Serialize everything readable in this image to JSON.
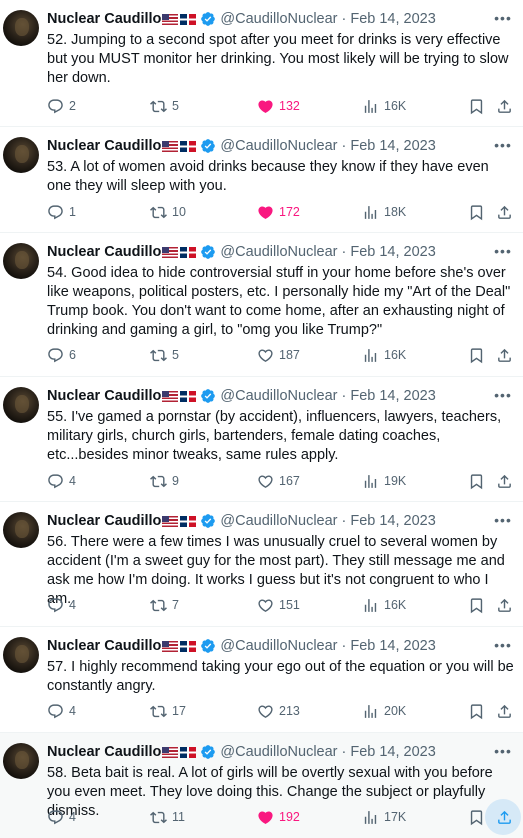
{
  "colors": {
    "like_active": "#f91880",
    "muted": "#536471",
    "text": "#0f1419",
    "highlight_bg": "#f7f9f9",
    "verified": "#1d9bf0"
  },
  "tweets": [
    {
      "name": "Nuclear Caudillo",
      "handle": "@CaudilloNuclear",
      "date": "Feb 14, 2023",
      "text": "52. Jumping to a second spot after you meet for drinks is very effective but you MUST monitor her drinking. You most likely will be trying to slow her down.",
      "replies": "2",
      "retweets": "5",
      "likes": "132",
      "liked": true,
      "views": "16K"
    },
    {
      "name": "Nuclear Caudillo",
      "handle": "@CaudilloNuclear",
      "date": "Feb 14, 2023",
      "text": "53.  A lot of women avoid drinks because they know if they have even one they will sleep with you.",
      "replies": "1",
      "retweets": "10",
      "likes": "172",
      "liked": true,
      "views": "18K"
    },
    {
      "name": "Nuclear Caudillo",
      "handle": "@CaudilloNuclear",
      "date": "Feb 14, 2023",
      "text": "54. Good idea to hide controversial stuff in your home before she's over like weapons, political posters, etc. I personally hide my \"Art of the Deal\" Trump book. You don't want to come home, after an exhausting night of drinking and gaming a girl, to \"omg you like Trump?\"",
      "replies": "6",
      "retweets": "5",
      "likes": "187",
      "liked": false,
      "views": "16K"
    },
    {
      "name": "Nuclear Caudillo",
      "handle": "@CaudilloNuclear",
      "date": "Feb 14, 2023",
      "text": "55. I've gamed a pornstar (by accident), influencers, lawyers, teachers, military girls, church girls, bartenders, female dating coaches, etc...besides minor tweaks, same rules apply.",
      "replies": "4",
      "retweets": "9",
      "likes": "167",
      "liked": false,
      "views": "19K"
    },
    {
      "name": "Nuclear Caudillo",
      "handle": "@CaudilloNuclear",
      "date": "Feb 14, 2023",
      "text": "56. There were a few times I was unusually cruel to several women by accident (I'm a sweet guy for the most part). They still message me and ask me how I'm doing. It works I guess but it's not congruent to who I am.",
      "replies": "4",
      "retweets": "7",
      "likes": "151",
      "liked": false,
      "views": "16K"
    },
    {
      "name": "Nuclear Caudillo",
      "handle": "@CaudilloNuclear",
      "date": "Feb 14, 2023",
      "text": "57. I highly recommend taking your ego out of the equation or you will be constantly angry.",
      "replies": "4",
      "retweets": "17",
      "likes": "213",
      "liked": false,
      "views": "20K"
    },
    {
      "name": "Nuclear Caudillo",
      "handle": "@CaudilloNuclear",
      "date": "Feb 14, 2023",
      "text": "58. Beta bait is real. A lot of girls will be overtly sexual with you before you even meet. They love doing this. Change the subject or playfully dismiss.",
      "replies": "4",
      "retweets": "11",
      "likes": "192",
      "liked": true,
      "views": "17K"
    }
  ]
}
